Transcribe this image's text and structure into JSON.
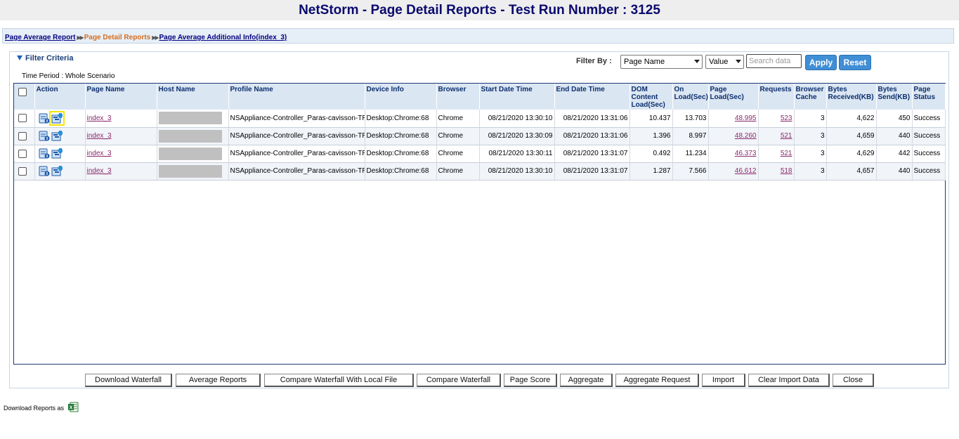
{
  "title": "NetStorm - Page Detail Reports - Test Run Number : 3125",
  "breadcrumb": {
    "link1": "Page Average Report",
    "current": "Page Detail Reports",
    "link2": "Page Average Additional Info(index_3)"
  },
  "filter": {
    "heading": "Filter Criteria",
    "label": "Filter By :",
    "field_select": "Page Name",
    "op_select": "Value",
    "search_placeholder": "Search data",
    "apply": "Apply",
    "reset": "Reset"
  },
  "time_period": "Time Period : Whole Scenario",
  "columns": [
    "",
    "Action",
    "Page Name",
    "Host Name",
    "Profile Name",
    "Device Info",
    "Browser",
    "Start Date Time",
    "End Date Time",
    "DOM Content Load(Sec)",
    "On Load(Sec)",
    "Page Load(Sec)",
    "Requests",
    "Browser Cache",
    "Bytes Received(KB)",
    "Bytes Send(KB)",
    "Page Status"
  ],
  "rows": [
    {
      "page": "index_3",
      "profile": "NSAppliance-Controller_Paras-cavisson-TR",
      "device": "Desktop:Chrome:68",
      "browser": "Chrome",
      "start": "08/21/2020 13:30:10",
      "end": "08/21/2020 13:31:06",
      "dom": "10.437",
      "onload": "13.703",
      "pageload": "48.995",
      "requests": "523",
      "cache": "3",
      "recv": "4,622",
      "send": "450",
      "status": "Success"
    },
    {
      "page": "index_3",
      "profile": "NSAppliance-Controller_Paras-cavisson-TR",
      "device": "Desktop:Chrome:68",
      "browser": "Chrome",
      "start": "08/21/2020 13:30:09",
      "end": "08/21/2020 13:31:06",
      "dom": "1.396",
      "onload": "8.997",
      "pageload": "48.260",
      "requests": "521",
      "cache": "3",
      "recv": "4,659",
      "send": "440",
      "status": "Success"
    },
    {
      "page": "index_3",
      "profile": "NSAppliance-Controller_Paras-cavisson-TR",
      "device": "Desktop:Chrome:68",
      "browser": "Chrome",
      "start": "08/21/2020 13:30:11",
      "end": "08/21/2020 13:31:07",
      "dom": "0.492",
      "onload": "11.234",
      "pageload": "46.373",
      "requests": "521",
      "cache": "3",
      "recv": "4,629",
      "send": "442",
      "status": "Success"
    },
    {
      "page": "index_3",
      "profile": "NSAppliance-Controller_Paras-cavisson-TR",
      "device": "Desktop:Chrome:68",
      "browser": "Chrome",
      "start": "08/21/2020 13:30:10",
      "end": "08/21/2020 13:31:07",
      "dom": "1.287",
      "onload": "7.566",
      "pageload": "46.612",
      "requests": "518",
      "cache": "3",
      "recv": "4,657",
      "send": "440",
      "status": "Success"
    }
  ],
  "buttons": [
    "Download Waterfall",
    "Average Reports",
    "Compare Waterfall With Local File",
    "Compare Waterfall",
    "Page Score",
    "Aggregate",
    "Aggregate Request",
    "Import",
    "Clear Import Data",
    "Close"
  ],
  "download_label": "Download Reports as",
  "icons": {
    "report": "report-icon",
    "waterfall": "waterfall-icon",
    "excel": "excel-icon",
    "filter_toggle": "triangle-down-icon"
  },
  "colors": {
    "title": "#0a0a6e",
    "accent": "#3f8ed6",
    "link": "#8a2b6c",
    "current_crumb": "#d76e1d",
    "highlight": "#f5e400"
  }
}
